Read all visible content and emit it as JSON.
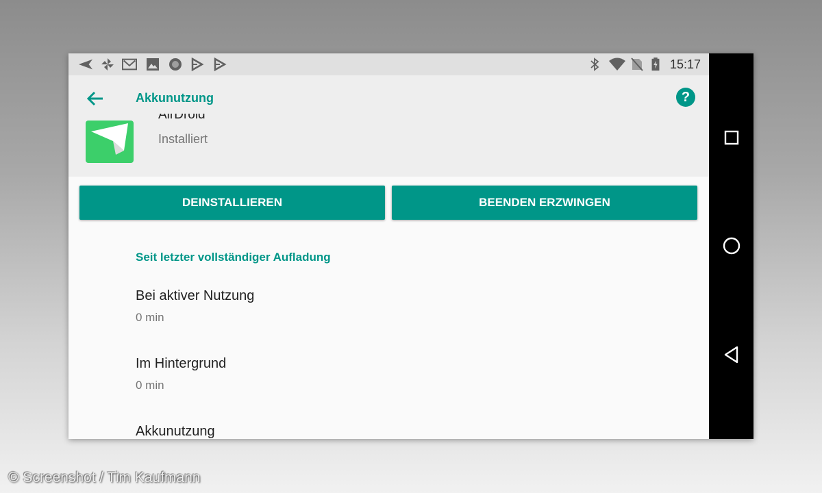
{
  "status_bar": {
    "time": "15:17",
    "left_icons": [
      "send-icon",
      "pinwheel-icon",
      "gmail-icon",
      "image-icon",
      "circle-record-icon",
      "play-store-icon",
      "play-store-icon"
    ],
    "right_icons": [
      "bluetooth-icon",
      "wifi-icon",
      "no-sim-icon",
      "battery-charging-icon"
    ]
  },
  "app_bar": {
    "title": "Akkunutzung",
    "back_icon": "arrow-left-icon",
    "help_icon": "help-circle-icon"
  },
  "app_info": {
    "name": "AirDroid",
    "status": "Installiert"
  },
  "actions": {
    "uninstall_label": "DEINSTALLIEREN",
    "force_stop_label": "BEENDEN ERZWINGEN"
  },
  "usage": {
    "section_header": "Seit letzter vollständiger Aufladung",
    "items": [
      {
        "title": "Bei aktiver Nutzung",
        "value": "0 min"
      },
      {
        "title": "Im Hintergrund",
        "value": "0 min"
      },
      {
        "title": "Akkunutzung"
      }
    ]
  },
  "nav_bar": {
    "buttons": [
      "recents-square-icon",
      "home-circle-icon",
      "back-triangle-icon"
    ]
  },
  "credit": "© Screenshot / Tim Kaufmann",
  "colors": {
    "accent": "#009688",
    "status_bar": "#e0e0e0",
    "app_bar": "#eeeeee",
    "background": "#fafafa",
    "app_icon_green": "#3ccf6a"
  }
}
